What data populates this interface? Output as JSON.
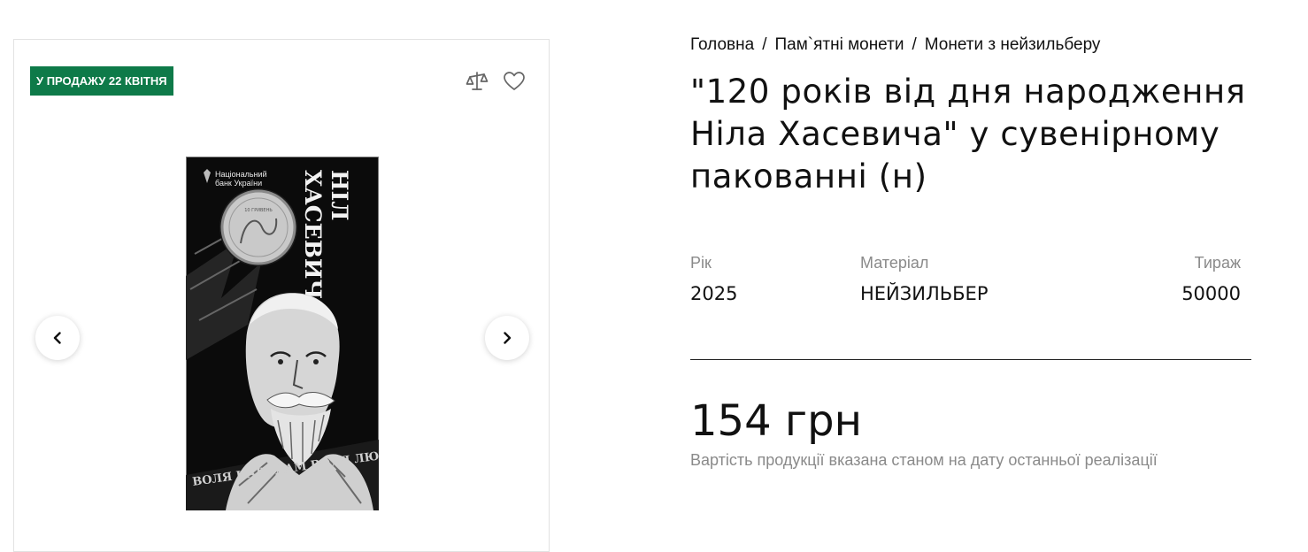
{
  "gallery": {
    "badge": "У ПРОДАЖУ 22 КВІТНЯ",
    "icons": {
      "compare": "scales-icon",
      "favorite": "heart-icon",
      "prev": "chevron-left-icon",
      "next": "chevron-right-icon"
    },
    "product_image": {
      "bank_name_line1": "Національний",
      "bank_name_line2": "банк України",
      "name_line1": "НІЛ",
      "name_line2": "ХАСЕВИЧ",
      "motto": "ВОЛЯ НАРОДАМ ВОЛЯ ЛЮДИНІ!"
    }
  },
  "breadcrumb": [
    {
      "label": "Головна"
    },
    {
      "label": "Пам`ятні монети"
    },
    {
      "label": "Монети з нейзильберу"
    }
  ],
  "breadcrumb_separator": "/",
  "product": {
    "title": "\"120 років від дня народження Ніла Хасевича\" у сувенірному пакованні (н)",
    "specs": {
      "year": {
        "label": "Рік",
        "value": "2025"
      },
      "material": {
        "label": "Матеріал",
        "value": "НЕЙЗИЛЬБЕР"
      },
      "mintage": {
        "label": "Тираж",
        "value": "50000"
      }
    },
    "price": "154 грн",
    "price_note": "Вартість продукції вказана станом на дату останньої реалізації"
  },
  "colors": {
    "badge_bg": "#0e7a49",
    "text": "#111111",
    "muted": "#8a8a8a",
    "border": "#e2e2e2"
  }
}
